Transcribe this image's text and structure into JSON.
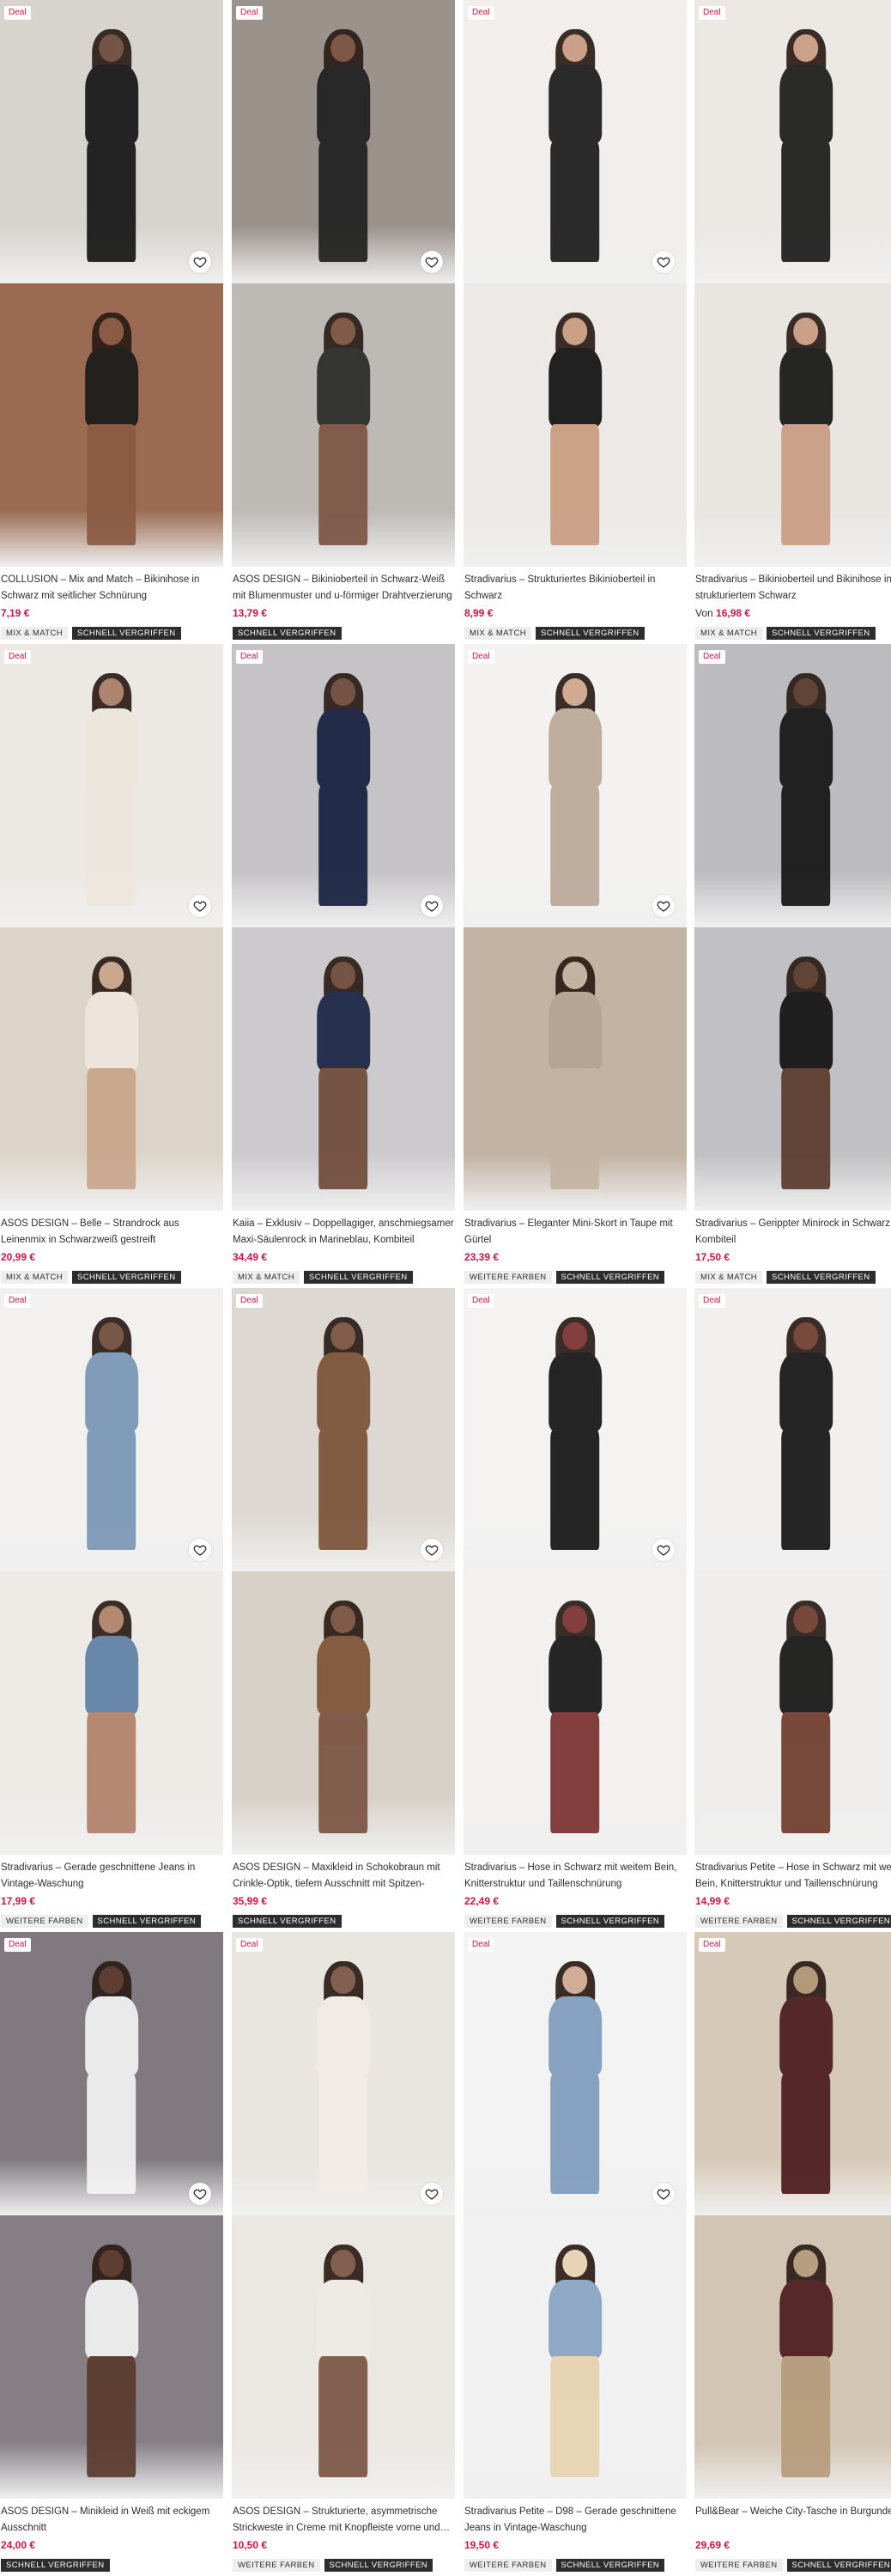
{
  "colors": {
    "deal_text": "#d01345",
    "price": "#d01345",
    "tag_dark_bg": "#2d2d2d",
    "tag_light_bg": "#eeeeee"
  },
  "products": [
    {
      "title": "COLLUSION – Mix and Match – Bikinihose in Schwarz mit seitlicher Schnürung",
      "price": "7,19 €",
      "price_prefix": "",
      "tags": [
        "MIX & MATCH",
        "SCHNELL VERGRIFFEN"
      ],
      "deal": true,
      "has_heart": true,
      "img1": {
        "bg": "#d7d4cd",
        "fig": "#6b4a3a",
        "cloth": "#151515"
      },
      "img2": {
        "bg": "#9a6b52",
        "fig": "#8a5a43",
        "cloth": "#1a1a1a"
      }
    },
    {
      "title": "ASOS DESIGN – Bikinioberteil in Schwarz-Weiß mit Blumenmuster und u-förmiger Drahtverzierung",
      "price": "13,79 €",
      "price_prefix": "",
      "tags": [
        "SCHNELL VERGRIFFEN"
      ],
      "deal": true,
      "has_heart": true,
      "img1": {
        "bg": "#9c928c",
        "fig": "#7b5442",
        "cloth": "#202020"
      },
      "img2": {
        "bg": "#bdb9b5",
        "fig": "#7b5442",
        "cloth": "#2a2a2a"
      }
    },
    {
      "title": "Stradivarius – Strukturiertes Bikinioberteil in Schwarz",
      "price": "8,99 €",
      "price_prefix": "",
      "tags": [
        "MIX & MATCH",
        "SCHNELL VERGRIFFEN"
      ],
      "deal": true,
      "has_heart": true,
      "img1": {
        "bg": "#f1eeec",
        "fig": "#c89a80",
        "cloth": "#1a1a1a"
      },
      "img2": {
        "bg": "#ece9e6",
        "fig": "#c89a80",
        "cloth": "#111111"
      }
    },
    {
      "title": "Stradivarius – Bikinioberteil und Bikinihose in strukturiertem Schwarz",
      "price": "16,98 €",
      "price_prefix": "Von ",
      "tags": [
        "MIX & MATCH",
        "SCHNELL VERGRIFFEN"
      ],
      "deal": true,
      "has_heart": false,
      "img1": {
        "bg": "#ece8e4",
        "fig": "#c99b82",
        "cloth": "#1a1a1a"
      },
      "img2": {
        "bg": "#e9e5e1",
        "fig": "#c99b82",
        "cloth": "#151515"
      }
    },
    {
      "title": "ASOS DESIGN – Belle – Strandrock aus Leinenmix in Schwarzweiß gestreift",
      "price": "20,99 €",
      "price_prefix": "",
      "tags": [
        "MIX & MATCH",
        "SCHNELL VERGRIFFEN"
      ],
      "deal": true,
      "has_heart": true,
      "img1": {
        "bg": "#ece8e3",
        "fig": "#a87c63",
        "cloth": "#eee6dc"
      },
      "img2": {
        "bg": "#ddd4c9",
        "fig": "#c9a58c",
        "cloth": "#efe7dd"
      }
    },
    {
      "title": "Kaiia – Exklusiv – Doppellagiger, anschmiegsamer Maxi-Säulenrock in Marineblau, Kombiteil",
      "price": "34,49 €",
      "price_prefix": "",
      "tags": [
        "MIX & MATCH",
        "SCHNELL VERGRIFFEN"
      ],
      "deal": true,
      "has_heart": true,
      "img1": {
        "bg": "#c6c3c6",
        "fig": "#6f4a3a",
        "cloth": "#15203f"
      },
      "img2": {
        "bg": "#cdcacd",
        "fig": "#6f4a3a",
        "cloth": "#1a2344"
      }
    },
    {
      "title": "Stradivarius – Eleganter Mini-Skort in Taupe mit Gürtel",
      "price": "23,39 €",
      "price_prefix": "",
      "tags": [
        "WEITERE FARBEN",
        "SCHNELL VERGRIFFEN"
      ],
      "deal": true,
      "has_heart": true,
      "img1": {
        "bg": "#f3f2f1",
        "fig": "#d0a48a",
        "cloth": "#bba898"
      },
      "img2": {
        "bg": "#c2b3a2",
        "fig": "#c2b3a2",
        "cloth": "#b4a492"
      }
    },
    {
      "title": "Stradivarius – Gerippter Minirock in Schwarz, Kombiteil",
      "price": "17,50 €",
      "price_prefix": "",
      "tags": [
        "MIX & MATCH",
        "SCHNELL VERGRIFFEN"
      ],
      "deal": true,
      "has_heart": false,
      "img1": {
        "bg": "#bcbbc0",
        "fig": "#5b3a2c",
        "cloth": "#151515"
      },
      "img2": {
        "bg": "#c1c0c4",
        "fig": "#5b3a2c",
        "cloth": "#121212"
      }
    },
    {
      "title": "Stradivarius – Gerade geschnittene Jeans in Vintage-Waschung",
      "price": "17,99 €",
      "price_prefix": "",
      "tags": [
        "WEITERE FARBEN",
        "SCHNELL VERGRIFFEN"
      ],
      "deal": true,
      "has_heart": true,
      "img1": {
        "bg": "#f2f1ef",
        "fig": "#6e4a3a",
        "cloth": "#7895b5"
      },
      "img2": {
        "bg": "#eeebe7",
        "fig": "#b08068",
        "cloth": "#5d7fa4"
      }
    },
    {
      "title": "ASOS DESIGN – Maxikleid in Schokobraun mit Crinkle-Optik, tiefem Ausschnitt mit Spitzen-Einsatz…",
      "price": "35,99 €",
      "price_prefix": "",
      "tags": [
        "SCHNELL VERGRIFFEN"
      ],
      "deal": true,
      "has_heart": true,
      "img1": {
        "bg": "#ddd8d1",
        "fig": "#7a5240",
        "cloth": "#7a5238"
      },
      "img2": {
        "bg": "#d8d1c8",
        "fig": "#7a5240",
        "cloth": "#7d5436"
      }
    },
    {
      "title": "Stradivarius – Hose in Schwarz mit weitem Bein, Knitterstruktur und Taillenschnürung",
      "price": "22,49 €",
      "price_prefix": "",
      "tags": [
        "WEITERE FARBEN",
        "SCHNELL VERGRIFFEN"
      ],
      "deal": true,
      "has_heart": true,
      "img1": {
        "bg": "#f4f3f2",
        "fig": "#7a2f2f",
        "cloth": "#141414"
      },
      "img2": {
        "bg": "#f2f1f0",
        "fig": "#7a2f2f",
        "cloth": "#141414"
      }
    },
    {
      "title": "Stradivarius Petite – Hose in Schwarz mit weitem Bein, Knitterstruktur und Taillenschnürung",
      "price": "14,99 €",
      "price_prefix": "",
      "tags": [
        "WEITERE FARBEN",
        "SCHNELL VERGRIFFEN"
      ],
      "deal": true,
      "has_heart": false,
      "img1": {
        "bg": "#f1f0ef",
        "fig": "#6e3c2c",
        "cloth": "#141414"
      },
      "img2": {
        "bg": "#efeeed",
        "fig": "#6e3c2c",
        "cloth": "#141414"
      }
    },
    {
      "title": "ASOS DESIGN – Minikleid in Weiß mit eckigem Ausschnitt",
      "price": "24,00 €",
      "price_prefix": "",
      "tags": [
        "SCHNELL VERGRIFFEN"
      ],
      "deal": true,
      "has_heart": true,
      "img1": {
        "bg": "#807a80",
        "fig": "#5a3a2c",
        "cloth": "#f4f4f4"
      },
      "img2": {
        "bg": "#857f85",
        "fig": "#5a3a2c",
        "cloth": "#f4f4f4"
      }
    },
    {
      "title": "ASOS DESIGN – Strukturierte, asymmetrische Strickweste in Creme mit Knopfleiste vorne und…",
      "price": "10,50 €",
      "price_prefix": "",
      "tags": [
        "WEITERE FARBEN",
        "SCHNELL VERGRIFFEN"
      ],
      "deal": true,
      "has_heart": true,
      "img1": {
        "bg": "#e9e5df",
        "fig": "#7a5442",
        "cloth": "#f1ede6"
      },
      "img2": {
        "bg": "#ebe7e2",
        "fig": "#7a5442",
        "cloth": "#efebe5"
      }
    },
    {
      "title": "Stradivarius Petite – D98 – Gerade geschnittene Jeans in Vintage-Waschung",
      "price": "19,50 €",
      "price_prefix": "",
      "tags": [
        "WEITERE FARBEN",
        "SCHNELL VERGRIFFEN"
      ],
      "deal": true,
      "has_heart": true,
      "img1": {
        "bg": "#f3f3f3",
        "fig": "#d0a890",
        "cloth": "#7e9cbd"
      },
      "img2": {
        "bg": "#f1f1f1",
        "fig": "#e6d2b0",
        "cloth": "#86a2c2"
      }
    },
    {
      "title": "Pull&Bear – Weiche City-Tasche in Burgunderrot",
      "price": "29,69 €",
      "price_prefix": "",
      "tags": [
        "WEITERE FARBEN",
        "SCHNELL VERGRIFFEN"
      ],
      "deal": true,
      "has_heart": false,
      "img1": {
        "bg": "#d6c9b7",
        "fig": "#b09577",
        "cloth": "#4a1a1c"
      },
      "img2": {
        "bg": "#d2c5b3",
        "fig": "#b59b7c",
        "cloth": "#4d1b1e"
      }
    }
  ],
  "labels": {
    "deal": "Deal"
  }
}
